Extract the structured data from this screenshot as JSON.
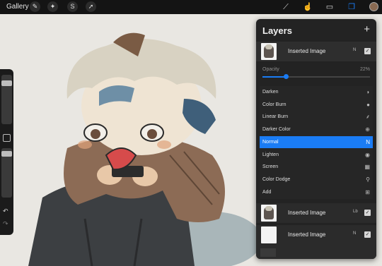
{
  "topbar": {
    "gallery_label": "Gallery",
    "left_tools": [
      "wrench-icon",
      "magic-wand-icon",
      "selection-icon",
      "transform-arrow-icon"
    ],
    "right_tools": [
      "brush-icon",
      "smudge-icon",
      "eraser-icon",
      "layers-icon"
    ],
    "color_swatch": "#8a6a52"
  },
  "layers_panel": {
    "title": "Layers",
    "add_symbol": "+",
    "active_layer": {
      "name": "Inserted Image",
      "mode": "N",
      "visible": true
    },
    "opacity": {
      "label": "Opacity",
      "value_text": "22%",
      "value": 0.22
    },
    "blend_modes": [
      {
        "label": "Darken",
        "icon": "◗"
      },
      {
        "label": "Color Burn",
        "icon": "●"
      },
      {
        "label": "Linear Burn",
        "icon": "⸙"
      },
      {
        "label": "Darker Color",
        "icon": "⊕"
      },
      {
        "label": "Normal",
        "icon": "N",
        "selected": true
      },
      {
        "label": "Lighten",
        "icon": "◉"
      },
      {
        "label": "Screen",
        "icon": "▦"
      },
      {
        "label": "Color Dodge",
        "icon": "⚲"
      },
      {
        "label": "Add",
        "icon": "⊞"
      }
    ],
    "layers": [
      {
        "name": "Inserted Image",
        "mode": "Lb",
        "visible": true
      },
      {
        "name": "Inserted Image",
        "mode": "N",
        "visible": true
      }
    ]
  },
  "colors": {
    "accent": "#1a7cf5"
  }
}
